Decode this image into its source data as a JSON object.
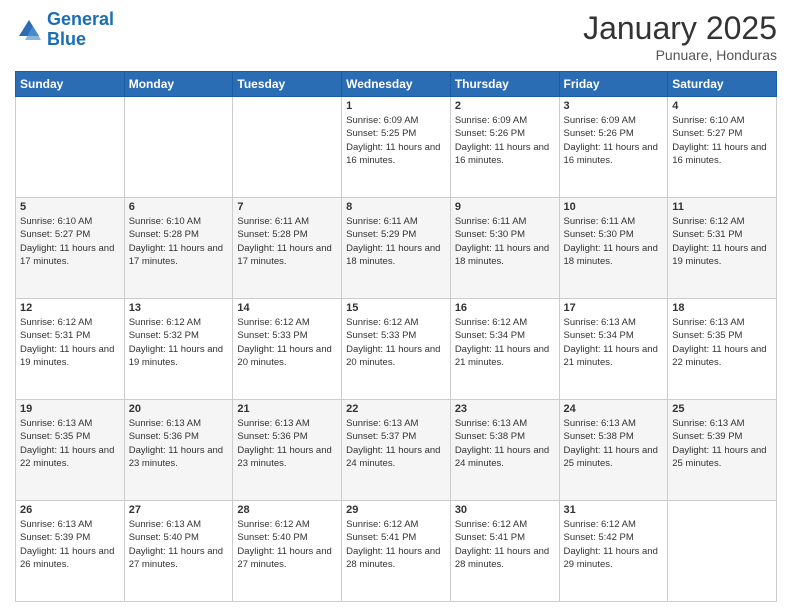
{
  "header": {
    "logo_line1": "General",
    "logo_line2": "Blue",
    "month": "January 2025",
    "location": "Punuare, Honduras"
  },
  "weekdays": [
    "Sunday",
    "Monday",
    "Tuesday",
    "Wednesday",
    "Thursday",
    "Friday",
    "Saturday"
  ],
  "weeks": [
    [
      {
        "day": "",
        "info": ""
      },
      {
        "day": "",
        "info": ""
      },
      {
        "day": "",
        "info": ""
      },
      {
        "day": "1",
        "info": "Sunrise: 6:09 AM\nSunset: 5:25 PM\nDaylight: 11 hours and 16 minutes."
      },
      {
        "day": "2",
        "info": "Sunrise: 6:09 AM\nSunset: 5:26 PM\nDaylight: 11 hours and 16 minutes."
      },
      {
        "day": "3",
        "info": "Sunrise: 6:09 AM\nSunset: 5:26 PM\nDaylight: 11 hours and 16 minutes."
      },
      {
        "day": "4",
        "info": "Sunrise: 6:10 AM\nSunset: 5:27 PM\nDaylight: 11 hours and 16 minutes."
      }
    ],
    [
      {
        "day": "5",
        "info": "Sunrise: 6:10 AM\nSunset: 5:27 PM\nDaylight: 11 hours and 17 minutes."
      },
      {
        "day": "6",
        "info": "Sunrise: 6:10 AM\nSunset: 5:28 PM\nDaylight: 11 hours and 17 minutes."
      },
      {
        "day": "7",
        "info": "Sunrise: 6:11 AM\nSunset: 5:28 PM\nDaylight: 11 hours and 17 minutes."
      },
      {
        "day": "8",
        "info": "Sunrise: 6:11 AM\nSunset: 5:29 PM\nDaylight: 11 hours and 18 minutes."
      },
      {
        "day": "9",
        "info": "Sunrise: 6:11 AM\nSunset: 5:30 PM\nDaylight: 11 hours and 18 minutes."
      },
      {
        "day": "10",
        "info": "Sunrise: 6:11 AM\nSunset: 5:30 PM\nDaylight: 11 hours and 18 minutes."
      },
      {
        "day": "11",
        "info": "Sunrise: 6:12 AM\nSunset: 5:31 PM\nDaylight: 11 hours and 19 minutes."
      }
    ],
    [
      {
        "day": "12",
        "info": "Sunrise: 6:12 AM\nSunset: 5:31 PM\nDaylight: 11 hours and 19 minutes."
      },
      {
        "day": "13",
        "info": "Sunrise: 6:12 AM\nSunset: 5:32 PM\nDaylight: 11 hours and 19 minutes."
      },
      {
        "day": "14",
        "info": "Sunrise: 6:12 AM\nSunset: 5:33 PM\nDaylight: 11 hours and 20 minutes."
      },
      {
        "day": "15",
        "info": "Sunrise: 6:12 AM\nSunset: 5:33 PM\nDaylight: 11 hours and 20 minutes."
      },
      {
        "day": "16",
        "info": "Sunrise: 6:12 AM\nSunset: 5:34 PM\nDaylight: 11 hours and 21 minutes."
      },
      {
        "day": "17",
        "info": "Sunrise: 6:13 AM\nSunset: 5:34 PM\nDaylight: 11 hours and 21 minutes."
      },
      {
        "day": "18",
        "info": "Sunrise: 6:13 AM\nSunset: 5:35 PM\nDaylight: 11 hours and 22 minutes."
      }
    ],
    [
      {
        "day": "19",
        "info": "Sunrise: 6:13 AM\nSunset: 5:35 PM\nDaylight: 11 hours and 22 minutes."
      },
      {
        "day": "20",
        "info": "Sunrise: 6:13 AM\nSunset: 5:36 PM\nDaylight: 11 hours and 23 minutes."
      },
      {
        "day": "21",
        "info": "Sunrise: 6:13 AM\nSunset: 5:36 PM\nDaylight: 11 hours and 23 minutes."
      },
      {
        "day": "22",
        "info": "Sunrise: 6:13 AM\nSunset: 5:37 PM\nDaylight: 11 hours and 24 minutes."
      },
      {
        "day": "23",
        "info": "Sunrise: 6:13 AM\nSunset: 5:38 PM\nDaylight: 11 hours and 24 minutes."
      },
      {
        "day": "24",
        "info": "Sunrise: 6:13 AM\nSunset: 5:38 PM\nDaylight: 11 hours and 25 minutes."
      },
      {
        "day": "25",
        "info": "Sunrise: 6:13 AM\nSunset: 5:39 PM\nDaylight: 11 hours and 25 minutes."
      }
    ],
    [
      {
        "day": "26",
        "info": "Sunrise: 6:13 AM\nSunset: 5:39 PM\nDaylight: 11 hours and 26 minutes."
      },
      {
        "day": "27",
        "info": "Sunrise: 6:13 AM\nSunset: 5:40 PM\nDaylight: 11 hours and 27 minutes."
      },
      {
        "day": "28",
        "info": "Sunrise: 6:12 AM\nSunset: 5:40 PM\nDaylight: 11 hours and 27 minutes."
      },
      {
        "day": "29",
        "info": "Sunrise: 6:12 AM\nSunset: 5:41 PM\nDaylight: 11 hours and 28 minutes."
      },
      {
        "day": "30",
        "info": "Sunrise: 6:12 AM\nSunset: 5:41 PM\nDaylight: 11 hours and 28 minutes."
      },
      {
        "day": "31",
        "info": "Sunrise: 6:12 AM\nSunset: 5:42 PM\nDaylight: 11 hours and 29 minutes."
      },
      {
        "day": "",
        "info": ""
      }
    ]
  ]
}
